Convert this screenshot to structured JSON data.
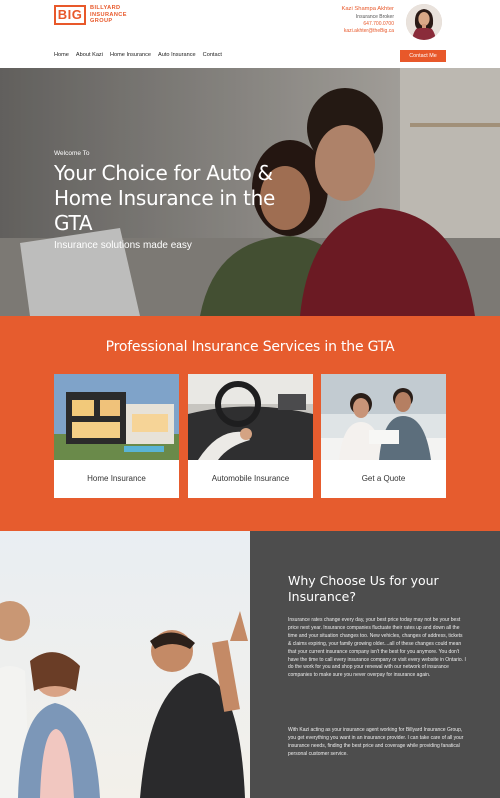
{
  "brand": {
    "logo_mark": "BIG",
    "logo_line1": "BILLYARD",
    "logo_line2": "INSURANCE",
    "logo_line3": "GROUP"
  },
  "agent": {
    "name": "Kazi Shampa Akhter",
    "title": "Insurance Broker",
    "phone": "647.700.0700",
    "email": "kazi.akhter@theBig.ca"
  },
  "nav": {
    "items": [
      "Home",
      "About Kazi",
      "Home Insurance",
      "Auto Insurance",
      "Contact"
    ],
    "cta": "Contact Me"
  },
  "hero": {
    "welcome": "Welcome To",
    "title": "Your Choice for Auto & Home Insurance in the GTA",
    "subtitle": "Insurance solutions made easy"
  },
  "services": {
    "title": "Professional Insurance Services in the GTA",
    "cards": [
      {
        "label": "Home Insurance"
      },
      {
        "label": "Automobile Insurance"
      },
      {
        "label": "Get a Quote"
      }
    ]
  },
  "why": {
    "title": "Why Choose Us for your Insurance?",
    "p1": "Insurance rates change every day, your best price today may not be your best price next year. Insurance companies fluctuate their rates up and down all the time and your situation changes too. New vehicles, changes of address, tickets & claims expiring, your family growing older....all of these changes could mean that your current insurance company isn't the best for you anymore. You don't have the time to call every insurance company or visit every website in Ontario. I do the work for you and shop your renewal with our network of insurance companies to make sure you never overpay for insurance again.",
    "p2": "With Kazi acting as your insurance agent working for Billyard Insurance Group, you get everything you want in an insurance provider. I can take care of all your insurance needs, finding the best price and coverage while providing fanatical personal customer service."
  },
  "colors": {
    "accent": "#e8582a",
    "services_bg": "#e65c2e",
    "panel_bg": "#4d4d4d"
  }
}
